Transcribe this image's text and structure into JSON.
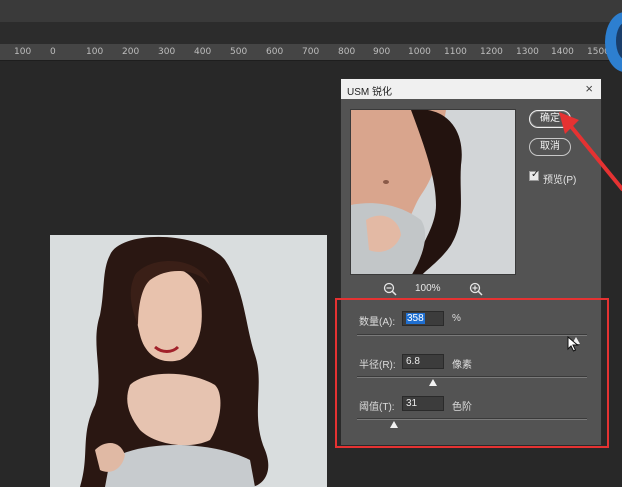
{
  "ruler": {
    "labels": [
      "100",
      "0",
      "100",
      "200",
      "300",
      "400",
      "500",
      "600",
      "700",
      "800",
      "900",
      "1000",
      "1100",
      "1200",
      "1300",
      "1400",
      "1500"
    ]
  },
  "dialog": {
    "title": "USM 锐化",
    "close_glyph": "×",
    "ok_label": "确定",
    "cancel_label": "取消",
    "preview_label": "预览(P)",
    "preview_checked": true,
    "zoom_level": "100%"
  },
  "params": {
    "amount": {
      "label": "数量(A):",
      "value": "358",
      "unit": "%",
      "slider_fraction": 0.95
    },
    "radius": {
      "label": "半径(R):",
      "value": "6.8",
      "unit": "像素",
      "slider_fraction": 0.33
    },
    "threshold": {
      "label": "阈值(T):",
      "value": "31",
      "unit": "色阶",
      "slider_fraction": 0.16
    }
  },
  "colors": {
    "highlight": "#e53232",
    "selection": "#1f6fd1",
    "dialog_bg": "#535353"
  },
  "icons": [
    "close-icon",
    "zoom-out-icon",
    "zoom-in-icon",
    "checkbox-icon",
    "mouse-cursor-icon",
    "red-arrow-icon"
  ]
}
